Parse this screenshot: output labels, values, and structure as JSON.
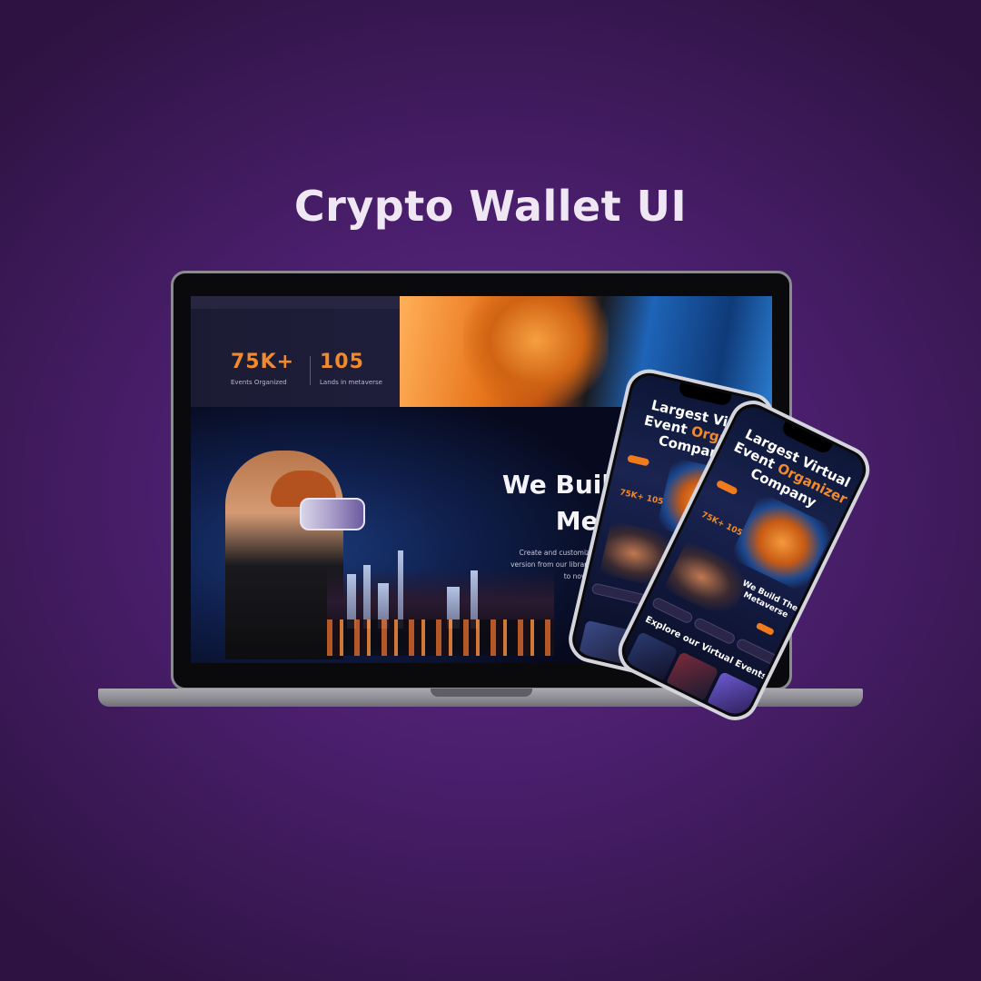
{
  "page": {
    "title": "Crypto Wallet UI"
  },
  "laptop": {
    "stats": [
      {
        "value": "75K+",
        "label": "Events Organized"
      },
      {
        "value": "105",
        "label": "Lands in metaverse"
      }
    ],
    "hero_heading_line1": "We Buil",
    "hero_heading_line2": "Met",
    "hero_body": "Create and customize yo a version from our librar model to now. Stand"
  },
  "phone_back": {
    "heading_pre": "Largest",
    "heading_mid": "Virtu",
    "heading_line2_pre": "Event",
    "heading_line2_accent": "Organiz",
    "heading_line3": "Company",
    "stats_text": "75K+  105",
    "section_heading": "Explore"
  },
  "phone_front": {
    "heading_pre": "Largest",
    "heading_mid": "Virtual",
    "heading_line2_pre": "Event",
    "heading_line2_accent": "Organizer",
    "heading_line3": "Company",
    "stats_text": "75K+  105",
    "build_text": "We Build The Metaverse",
    "section_heading": "Explore our Virtual Events"
  },
  "colors": {
    "accent": "#f08a2c",
    "background": "#4b1f6e",
    "title": "#efe8f4"
  }
}
